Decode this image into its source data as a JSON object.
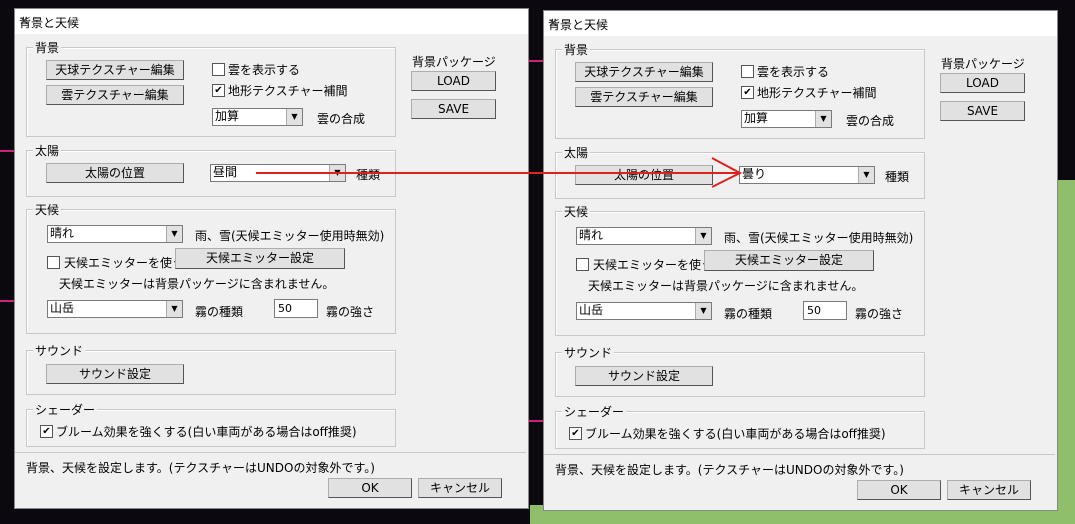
{
  "dialogs": [
    {
      "title": "背景と天候",
      "bg_group": "背景",
      "sky_texture_btn": "天球テクスチャー編集",
      "cloud_texture_btn": "雲テクスチャー編集",
      "show_clouds": {
        "label": "雲を表示する",
        "checked": false
      },
      "terrain_interp": {
        "label": "地形テクスチャー補間",
        "checked": true
      },
      "cloud_blend": {
        "value": "加算",
        "label": "雲の合成"
      },
      "package_label": "背景パッケージ",
      "load_btn": "LOAD",
      "save_btn": "SAVE",
      "sun_group": "太陽",
      "sun_pos_btn": "太陽の位置",
      "sun_type": {
        "value": "昼間",
        "label": "種類"
      },
      "weather_group": "天候",
      "weather": {
        "value": "晴れ",
        "label": "雨、雪(天候エミッター使用時無効)"
      },
      "use_emitter": {
        "label": "天候エミッターを使う",
        "checked": false
      },
      "emitter_btn": "天候エミッター設定",
      "emitter_note": "天候エミッターは背景パッケージに含まれません。",
      "fog_type": {
        "value": "山岳",
        "label": "霧の種類"
      },
      "fog_strength": {
        "value": "50",
        "label": "霧の強さ"
      },
      "sound_group": "サウンド",
      "sound_btn": "サウンド設定",
      "shader_group": "シェーダー",
      "bloom": {
        "label": "ブルーム効果を強くする(白い車両がある場合はoff推奨)",
        "checked": true
      },
      "status": "背景、天候を設定します。(テクスチャーはUNDOの対象外です。)",
      "ok_btn": "OK",
      "cancel_btn": "キャンセル"
    },
    {
      "title": "背景と天候",
      "bg_group": "背景",
      "sky_texture_btn": "天球テクスチャー編集",
      "cloud_texture_btn": "雲テクスチャー編集",
      "show_clouds": {
        "label": "雲を表示する",
        "checked": false
      },
      "terrain_interp": {
        "label": "地形テクスチャー補間",
        "checked": true
      },
      "cloud_blend": {
        "value": "加算",
        "label": "雲の合成"
      },
      "package_label": "背景パッケージ",
      "load_btn": "LOAD",
      "save_btn": "SAVE",
      "sun_group": "太陽",
      "sun_pos_btn": "太陽の位置",
      "sun_type": {
        "value": "曇り",
        "label": "種類"
      },
      "weather_group": "天候",
      "weather": {
        "value": "晴れ",
        "label": "雨、雪(天候エミッター使用時無効)"
      },
      "use_emitter": {
        "label": "天候エミッターを使う",
        "checked": false
      },
      "emitter_btn": "天候エミッター設定",
      "emitter_note": "天候エミッターは背景パッケージに含まれません。",
      "fog_type": {
        "value": "山岳",
        "label": "霧の種類"
      },
      "fog_strength": {
        "value": "50",
        "label": "霧の強さ"
      },
      "sound_group": "サウンド",
      "sound_btn": "サウンド設定",
      "shader_group": "シェーダー",
      "bloom": {
        "label": "ブルーム効果を強くする(白い車両がある場合はoff推奨)",
        "checked": true
      },
      "status": "背景、天候を設定します。(テクスチャーはUNDOの対象外です。)",
      "ok_btn": "OK",
      "cancel_btn": "キャンセル"
    }
  ],
  "annotation_color": "#e0201c",
  "check_mark": "✔",
  "combo_arrow": "▼",
  "close_glyph": "✕"
}
